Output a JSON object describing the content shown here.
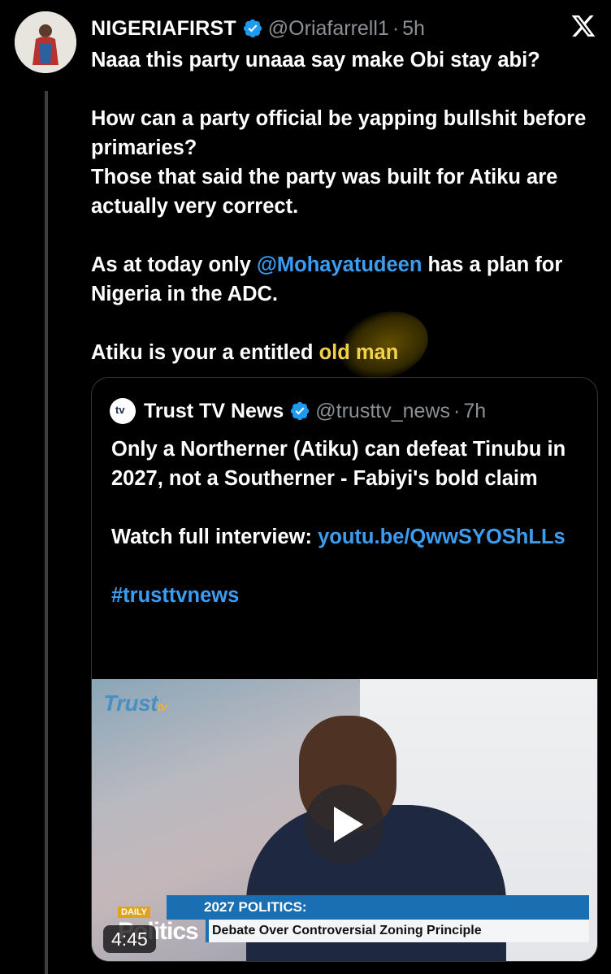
{
  "tweet": {
    "author_name": "NIGERIAFIRST",
    "handle": "@Oriafarrell1",
    "separator": "·",
    "time": "5h",
    "lines": {
      "l1": "Naaa this party unaaa say make Obi stay abi?",
      "l2": "How can a party official be yapping bullshit before primaries?",
      "l3": "Those that said the party was built for Atiku are actually very correct.",
      "l4_pre": "As at today only ",
      "l4_mention": "@Mohayatudeen",
      "l4_post": " has a plan for Nigeria in the ADC.",
      "l5_pre": "Atiku is your a entitled ",
      "l5_highlight": "old man"
    }
  },
  "quote": {
    "author_name": "Trust TV News",
    "logo_text": "tv",
    "handle": "@trusttv_news",
    "separator": "·",
    "time": "7h",
    "text_main": "Only a Northerner (Atiku) can defeat Tinubu in 2027, not a Southerner - Fabiyi's bold claim",
    "watch_pre": "Watch full interview: ",
    "watch_link": "youtu.be/QwwSYOShLLs",
    "hashtag": "#trusttvnews",
    "video": {
      "brand": "Trust",
      "brand_sub": "tv",
      "banner_top": "2027 POLITICS:",
      "banner_bottom": "Debate Over Controversial Zoning Principle",
      "show_small": "DAILY",
      "show_big": "Politics",
      "duration": "4:45"
    }
  },
  "icons": {
    "verified": "verified-badge-icon",
    "close": "x-logo-icon",
    "play": "play-icon"
  },
  "colors": {
    "background": "#000000",
    "link": "#3b9cf0",
    "highlight": "#f2d24b",
    "verified": "#1d9bf0"
  }
}
